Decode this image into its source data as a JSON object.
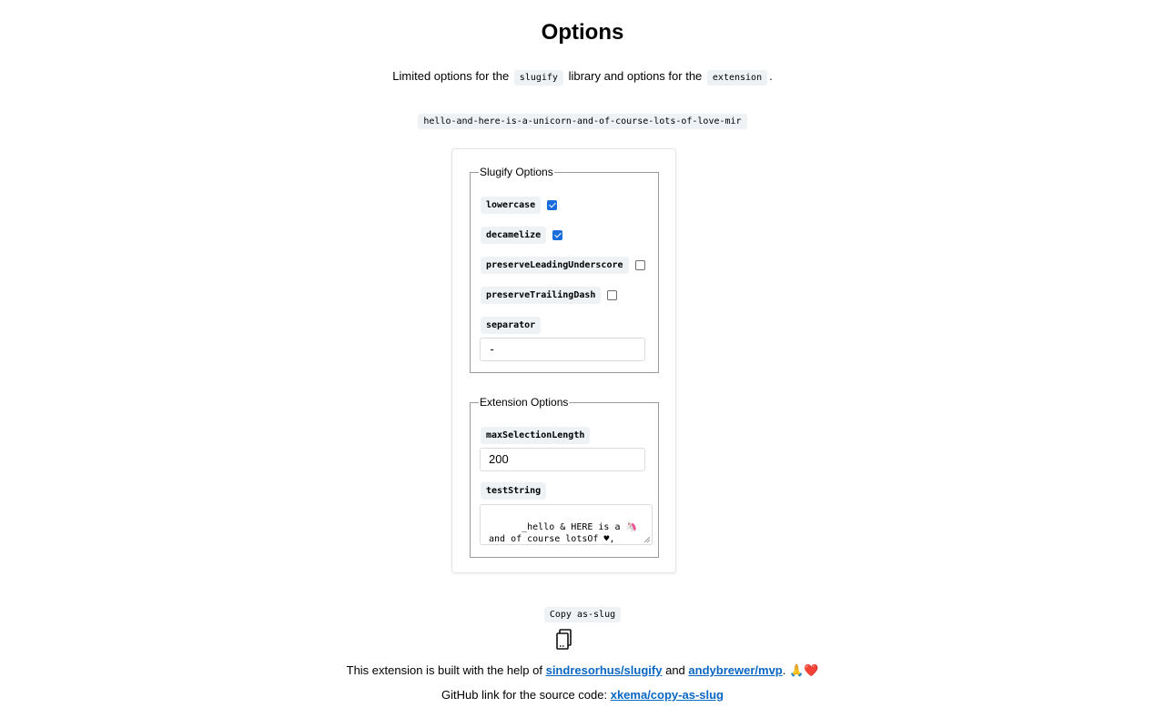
{
  "page": {
    "title": "Options",
    "intro": {
      "before": "Limited options for the",
      "lib_code": "slugify",
      "middle": "library and options for the",
      "ext_code": "extension",
      "after": "."
    },
    "slug_preview": "hello-and-here-is-a-unicorn-and-of-course-lots-of-love-mir"
  },
  "slugify_options": {
    "legend": "Slugify Options",
    "lowercase": {
      "label": "lowercase",
      "checked": true
    },
    "decamelize": {
      "label": "decamelize",
      "checked": true
    },
    "preserveLeadingUnderscore": {
      "label": "preserveLeadingUnderscore",
      "checked": false
    },
    "preserveTrailingDash": {
      "label": "preserveTrailingDash",
      "checked": false
    },
    "separator": {
      "label": "separator",
      "value": "-"
    }
  },
  "extension_options": {
    "legend": "Extension Options",
    "maxSelectionLength": {
      "label": "maxSelectionLength",
      "value": "200"
    },
    "testString": {
      "label": "testString",
      "value": "_hello & HERE is a 🦄 and of course lotsOf ♥, Мир!-"
    }
  },
  "copy": {
    "label": "Copy as-slug",
    "icon": "copy-icon"
  },
  "footer": {
    "line1_before": "This extension is built with the help of",
    "link1": "sindresorhus/slugify",
    "and": "and",
    "link2": "andybrewer/mvp",
    "line1_after": ". 🙏❤️",
    "line2_before": "GitHub link for the source code:",
    "link3": "xkema/copy-as-slug"
  },
  "colors": {
    "link": "#0a66c2",
    "checkbox_checked": "#1a6ddb",
    "code_bg": "#eef2f5"
  }
}
